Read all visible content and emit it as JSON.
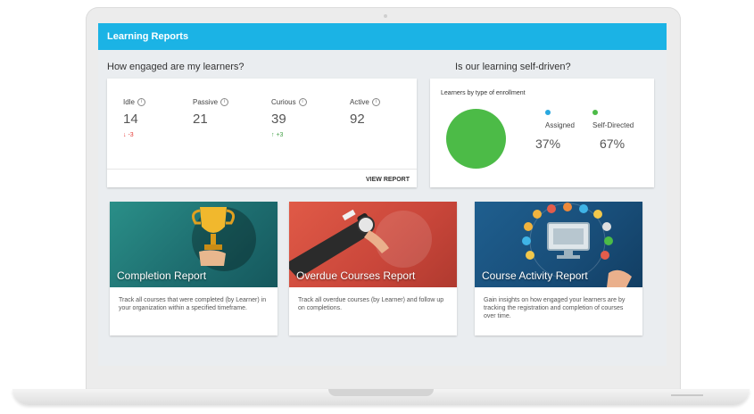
{
  "header": {
    "title": "Learning Reports"
  },
  "engagement": {
    "title": "How engaged are my learners?",
    "metrics": [
      {
        "label": "Idle",
        "value": "14",
        "delta": "-3",
        "trend": "down"
      },
      {
        "label": "Passive",
        "value": "21",
        "delta": "",
        "trend": "none"
      },
      {
        "label": "Curious",
        "value": "39",
        "delta": "+3",
        "trend": "up"
      },
      {
        "label": "Active",
        "value": "92",
        "delta": "",
        "trend": "none"
      }
    ],
    "view_report": "VIEW REPORT"
  },
  "self_driven": {
    "title": "Is our learning self-driven?",
    "card_title": "Learners by type of enrollment",
    "legend": [
      {
        "label": "Assigned",
        "value": "37%",
        "color": "#29a8e0"
      },
      {
        "label": "Self-Directed",
        "value": "67%",
        "color": "#4cbb47"
      }
    ],
    "pie_color": "#4cbb47"
  },
  "reports": [
    {
      "title": "Completion Report",
      "description": "Track all courses that were completed (by Learner) in your organization within a specified timeframe.",
      "icon": "trophy-icon"
    },
    {
      "title": "Overdue Courses Report",
      "description": "Track all overdue courses (by Learner) and follow up on completions.",
      "icon": "wristwatch-icon"
    },
    {
      "title": "Course Activity Report",
      "description": "Gain insights on how engaged your learners are by tracking the registration and completion of courses over time.",
      "icon": "monitor-icon"
    }
  ]
}
